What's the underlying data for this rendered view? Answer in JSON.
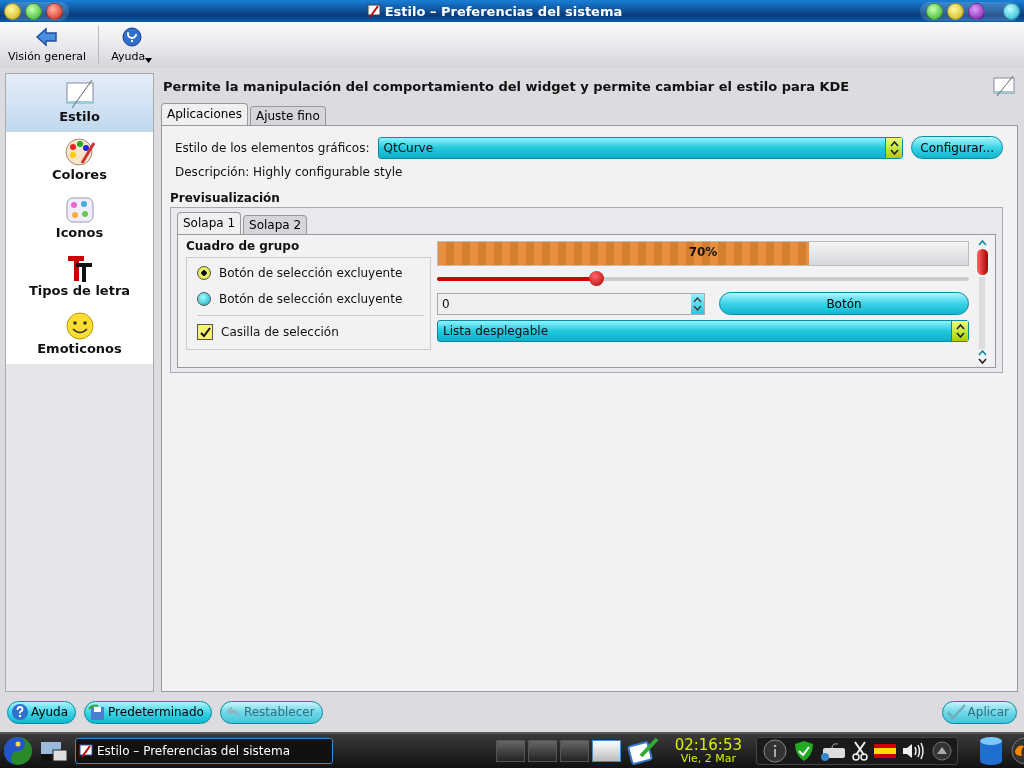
{
  "window": {
    "title": "Estilo – Preferencias del sistema"
  },
  "toolbar": [
    {
      "label": "Visión general",
      "kind": "back"
    },
    {
      "label": "Ayuda",
      "kind": "help"
    }
  ],
  "sidebar": {
    "items": [
      {
        "label": "Estilo",
        "selected": true,
        "kind": "style"
      },
      {
        "label": "Colores",
        "selected": false,
        "kind": "colors"
      },
      {
        "label": "Iconos",
        "selected": false,
        "kind": "icons"
      },
      {
        "label": "Tipos de letra",
        "selected": false,
        "kind": "fonts"
      },
      {
        "label": "Emoticonos",
        "selected": false,
        "kind": "emoticons"
      }
    ]
  },
  "header": "Permite la manipulación del comportamiento del widget y permite cambiar el estilo para KDE",
  "tabs": [
    {
      "label": "Aplicaciones",
      "selected": true
    },
    {
      "label": "Ajuste fino",
      "selected": false
    }
  ],
  "style_field": {
    "label": "Estilo de los elementos gráficos:",
    "value": "QtCurve"
  },
  "configure_button": "Configurar...",
  "description": "Descripción: Highly configurable style",
  "preview": {
    "title": "Previsualización",
    "tabs": [
      {
        "label": "Solapa 1",
        "selected": true
      },
      {
        "label": "Solapa 2",
        "selected": false
      }
    ],
    "group": {
      "title": "Cuadro de grupo",
      "radios": [
        {
          "label": "Botón de selección excluyente",
          "selected": true
        },
        {
          "label": "Botón de selección excluyente",
          "selected": false
        }
      ],
      "checkbox": {
        "label": "Casilla de selección",
        "checked": true
      }
    },
    "progress": {
      "level": 0.7,
      "reading": "70%"
    },
    "slider": {
      "level": 0.3
    },
    "spin": {
      "value": "0"
    },
    "button": "Botón",
    "combo": {
      "value": "Lista desplegable"
    }
  },
  "buttons": [
    {
      "label": "Ayuda",
      "disabled": false,
      "kind": "help"
    },
    {
      "label": "Predeterminado",
      "disabled": false,
      "kind": "save"
    },
    {
      "label": "Restablecer",
      "disabled": true,
      "kind": "undo"
    },
    {
      "label": "Aplicar",
      "disabled": true,
      "kind": "apply"
    }
  ],
  "taskbar": {
    "task": "Estilo – Preferencias del sistema",
    "desktops": [
      {
        "selected": false
      },
      {
        "selected": false
      },
      {
        "selected": false
      },
      {
        "selected": true
      }
    ],
    "clock": {
      "time": "02:16:53",
      "date": "Vie, 2 Mar"
    }
  }
}
